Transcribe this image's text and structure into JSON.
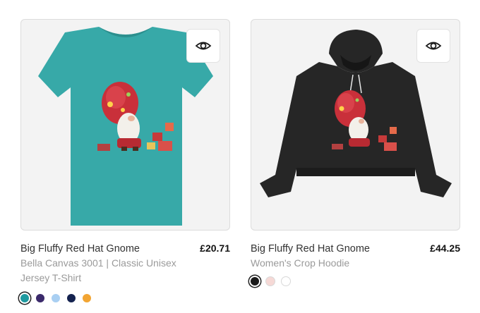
{
  "products": [
    {
      "title": "Big Fluffy Red Hat Gnome",
      "price": "£20.71",
      "subtitle": "Bella Canvas 3001 | Classic Unisex Jersey T-Shirt",
      "garment": "tshirt",
      "garment_color": "#37a9a8",
      "quick_view_icon": "eye-icon",
      "swatches": [
        {
          "color": "#1f9aa0",
          "selected": true
        },
        {
          "color": "#3b2a6b",
          "selected": false
        },
        {
          "color": "#a9cff2",
          "selected": false
        },
        {
          "color": "#14224f",
          "selected": false
        },
        {
          "color": "#f2a533",
          "selected": false
        }
      ]
    },
    {
      "title": "Big Fluffy Red Hat Gnome",
      "price": "£44.25",
      "subtitle": "Women's Crop Hoodie",
      "garment": "hoodie",
      "garment_color": "#262626",
      "quick_view_icon": "eye-icon",
      "swatches": [
        {
          "color": "#1a1a1a",
          "selected": true
        },
        {
          "color": "#f6d9d6",
          "selected": false
        },
        {
          "color": "#ffffff",
          "selected": false
        }
      ]
    }
  ]
}
